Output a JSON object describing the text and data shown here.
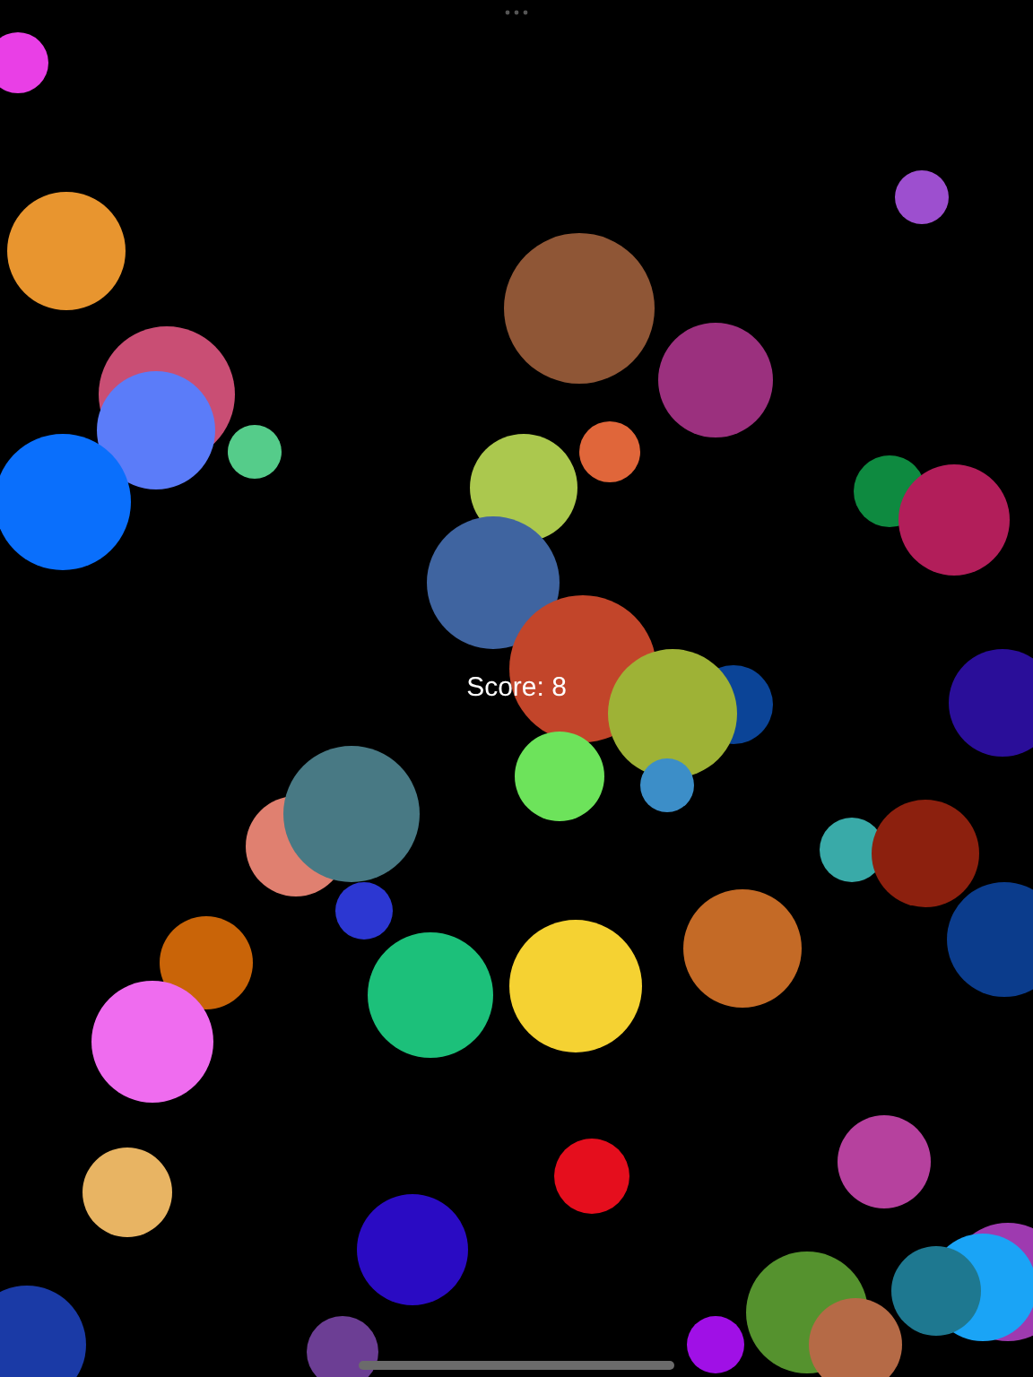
{
  "score": "Score: 8"
}
